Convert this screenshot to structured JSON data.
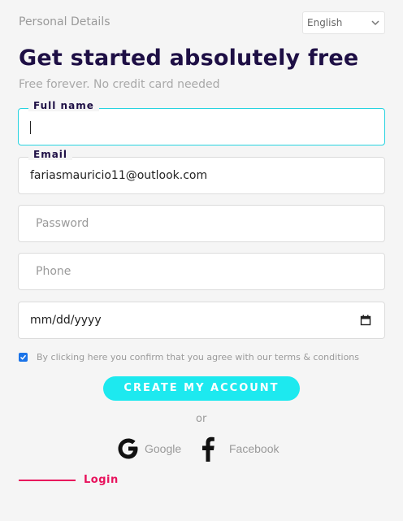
{
  "header": {
    "section_label": "Personal Details",
    "language": "English"
  },
  "hero": {
    "title": "Get started absolutely free",
    "subtitle": "Free forever. No credit card needed"
  },
  "form": {
    "full_name": {
      "label": "Full name",
      "value": ""
    },
    "email": {
      "label": "Email",
      "value": "fariasmauricio11@outlook.com"
    },
    "password": {
      "placeholder": "Password"
    },
    "phone": {
      "placeholder": "Phone"
    },
    "date": {
      "placeholder": "mm/dd/yyyy"
    },
    "consent": {
      "checked": true,
      "text": "By clicking here you confirm that you agree with our terms & conditions"
    },
    "submit_label": "CREATE MY ACCOUNT"
  },
  "social": {
    "divider": "or",
    "google": {
      "label": "Google",
      "icon": "google-icon"
    },
    "facebook": {
      "label": "Facebook",
      "icon": "facebook-icon"
    }
  },
  "footer": {
    "login_label": "Login"
  },
  "colors": {
    "title": "#1e0f45",
    "accent": "#1de9ef",
    "focus_border": "#27d3e0",
    "login": "#e8125c",
    "checkbox": "#1a73e8"
  }
}
